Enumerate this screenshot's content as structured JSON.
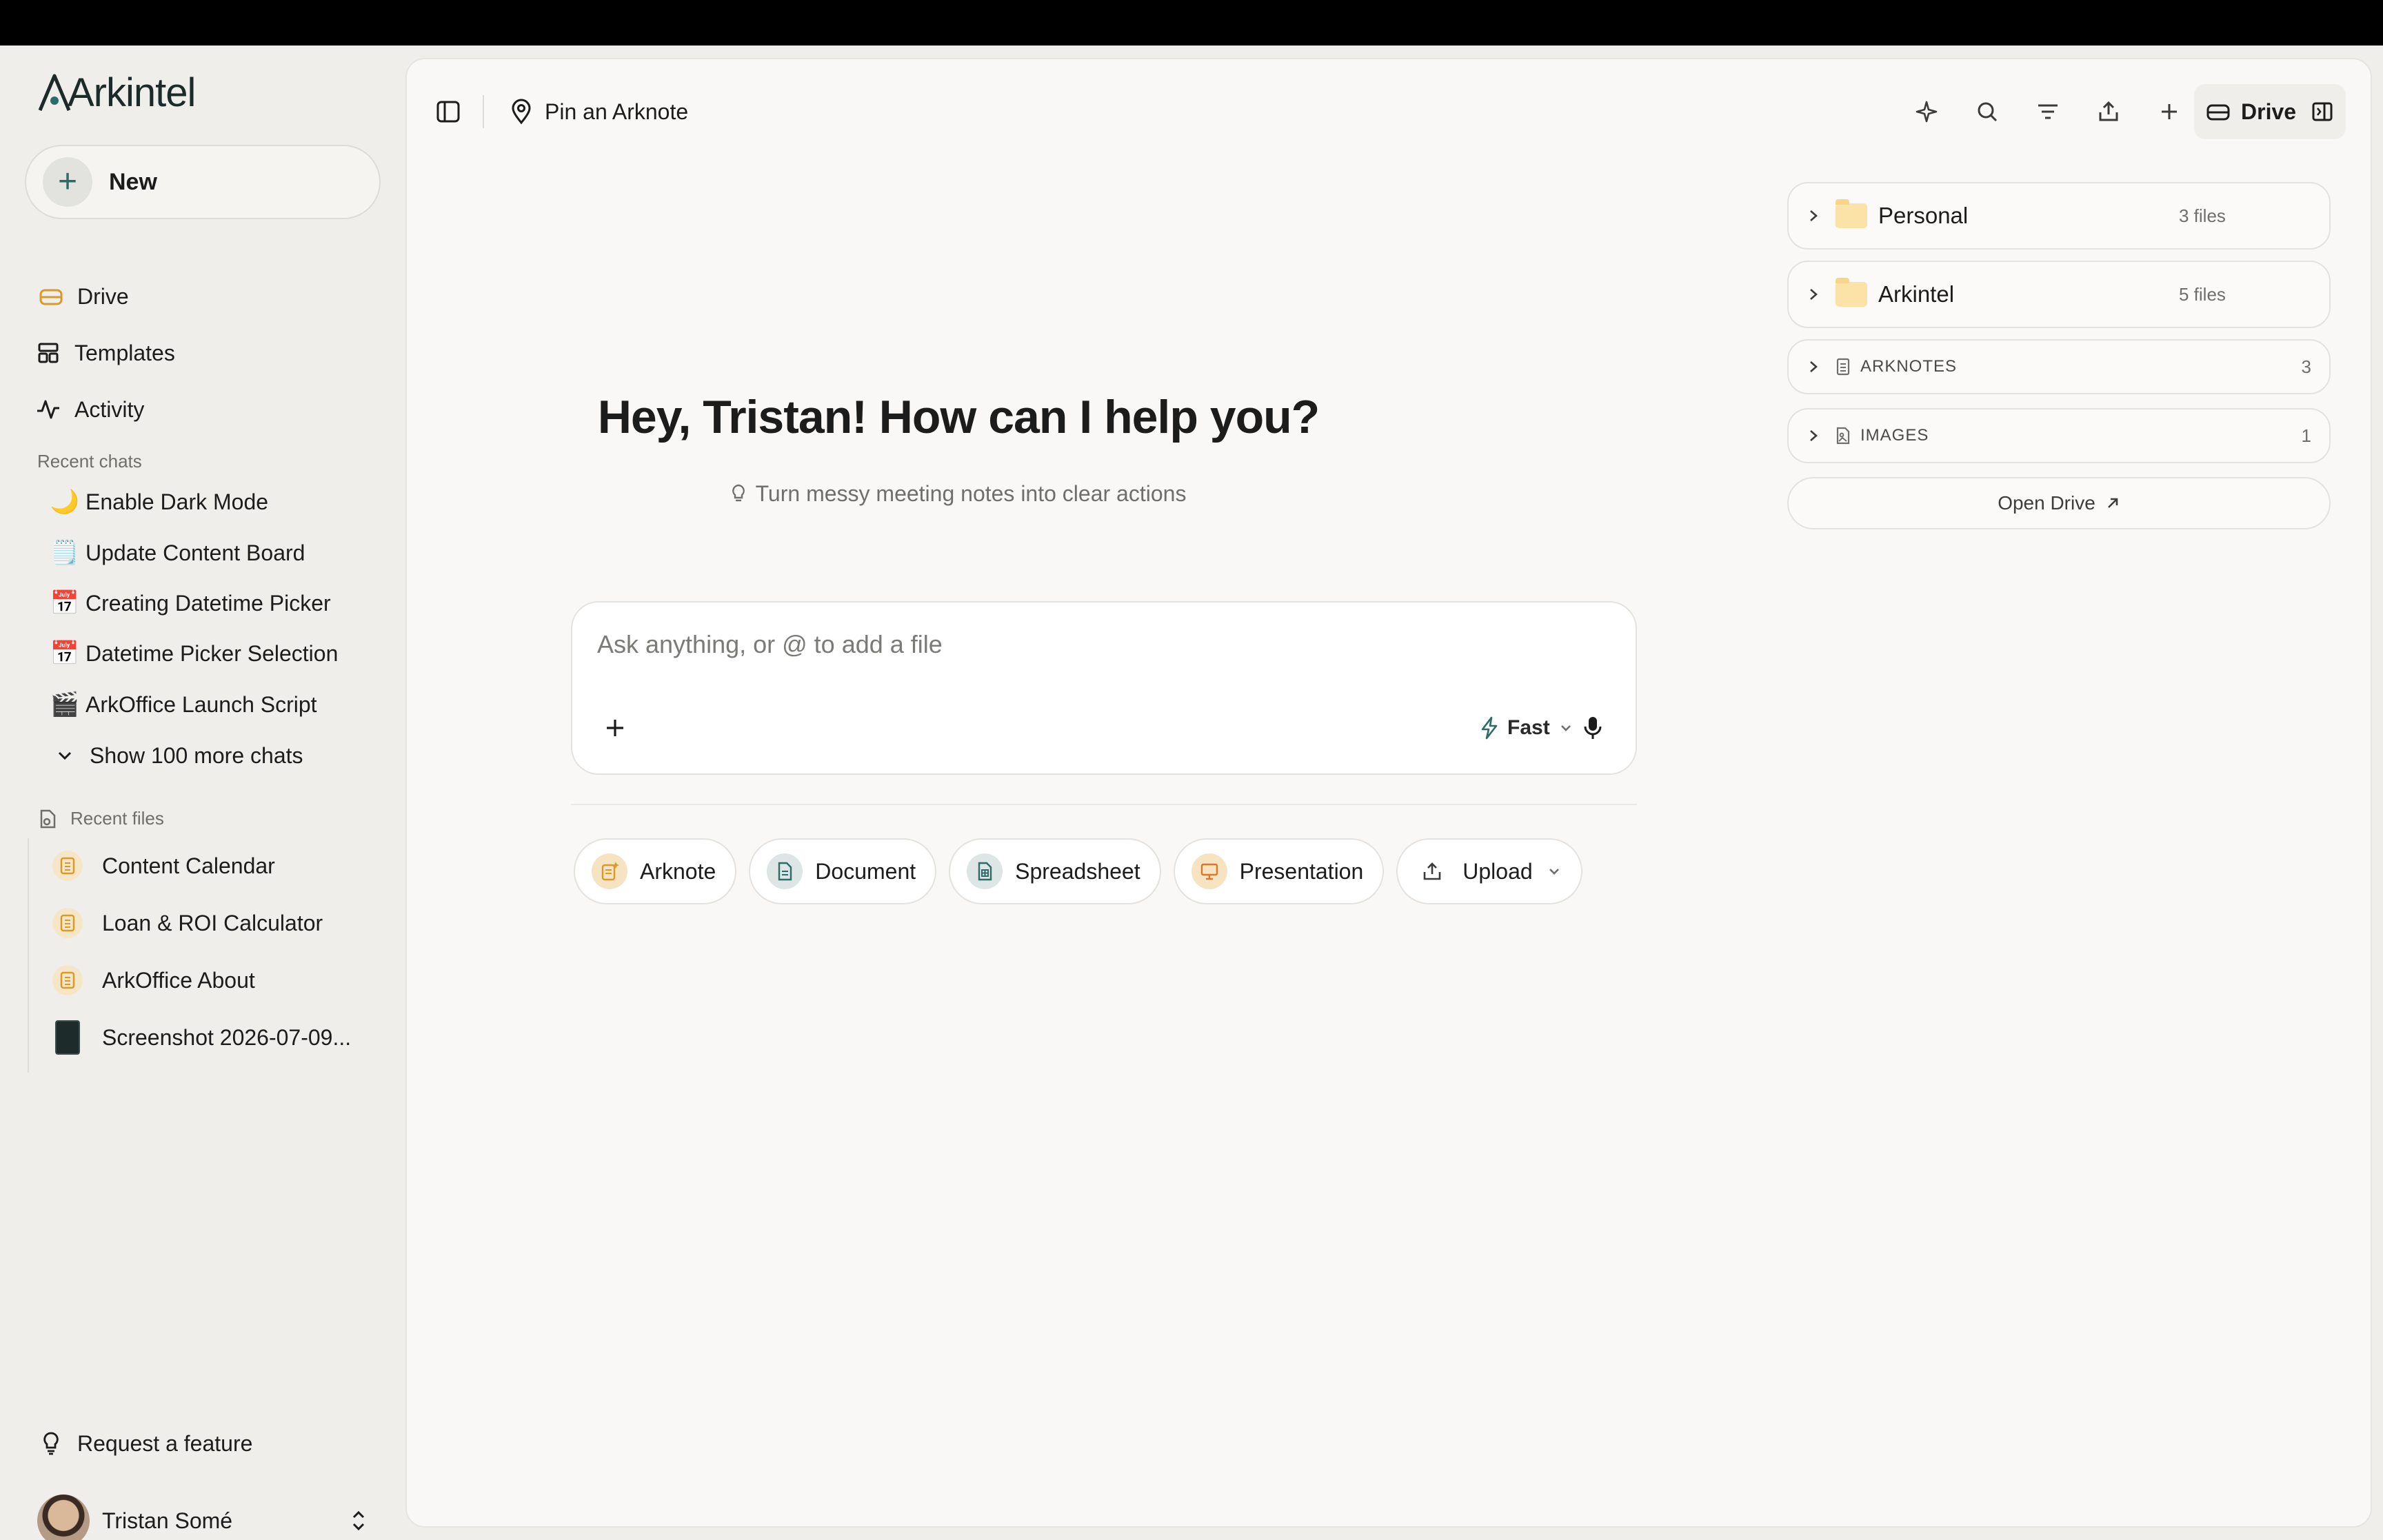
{
  "brand": {
    "name": "Arkintel"
  },
  "sidebar": {
    "new_label": "New",
    "nav": [
      {
        "label": "Drive",
        "icon": "drive-icon"
      },
      {
        "label": "Templates",
        "icon": "templates-icon"
      },
      {
        "label": "Activity",
        "icon": "activity-icon"
      }
    ],
    "recent_chats_label": "Recent chats",
    "recent_chats": [
      {
        "emoji": "🌙",
        "label": "Enable Dark Mode"
      },
      {
        "emoji": "🗒️",
        "label": "Update Content Board"
      },
      {
        "emoji": "📅",
        "label": "Creating Datetime Picker"
      },
      {
        "emoji": "📅",
        "label": "Datetime Picker Selection"
      },
      {
        "emoji": "🎬",
        "label": "ArkOffice Launch Script"
      }
    ],
    "show_more": "Show 100 more chats",
    "recent_files_label": "Recent files",
    "recent_files": [
      {
        "label": "Content Calendar",
        "icon": "arknote-icon"
      },
      {
        "label": "Loan & ROI Calculator",
        "icon": "arknote-icon"
      },
      {
        "label": "ArkOffice About",
        "icon": "arknote-icon"
      },
      {
        "label": "Screenshot 2026-07-09...",
        "icon": "image-thumbnail"
      }
    ],
    "request_feature": "Request a feature",
    "user_name": "Tristan Somé"
  },
  "topbar": {
    "pin_label": "Pin an Arknote",
    "drive_label": "Drive",
    "icons": [
      "sparkle-icon",
      "search-icon",
      "filter-icon",
      "share-icon",
      "plus-icon"
    ]
  },
  "main": {
    "greeting": "Hey, Tristan! How can I help you?",
    "hint": "Turn messy meeting notes into clear actions",
    "composer": {
      "placeholder": "Ask anything, or @ to add a file",
      "mode": "Fast"
    },
    "chips": [
      {
        "label": "Arknote"
      },
      {
        "label": "Document"
      },
      {
        "label": "Spreadsheet"
      },
      {
        "label": "Presentation"
      },
      {
        "label": "Upload"
      }
    ]
  },
  "drive_panel": {
    "folders": [
      {
        "name": "Personal",
        "count": "3 files"
      },
      {
        "name": "Arkintel",
        "count": "5 files"
      }
    ],
    "sections": [
      {
        "name": "ARKNOTES",
        "count": "3"
      },
      {
        "name": "IMAGES",
        "count": "1"
      }
    ],
    "open_drive": "Open Drive"
  },
  "colors": {
    "accent": "#2c6b68",
    "arknote": "#d99a2b",
    "background": "#efeeeb",
    "panel": "#f9f8f6"
  }
}
